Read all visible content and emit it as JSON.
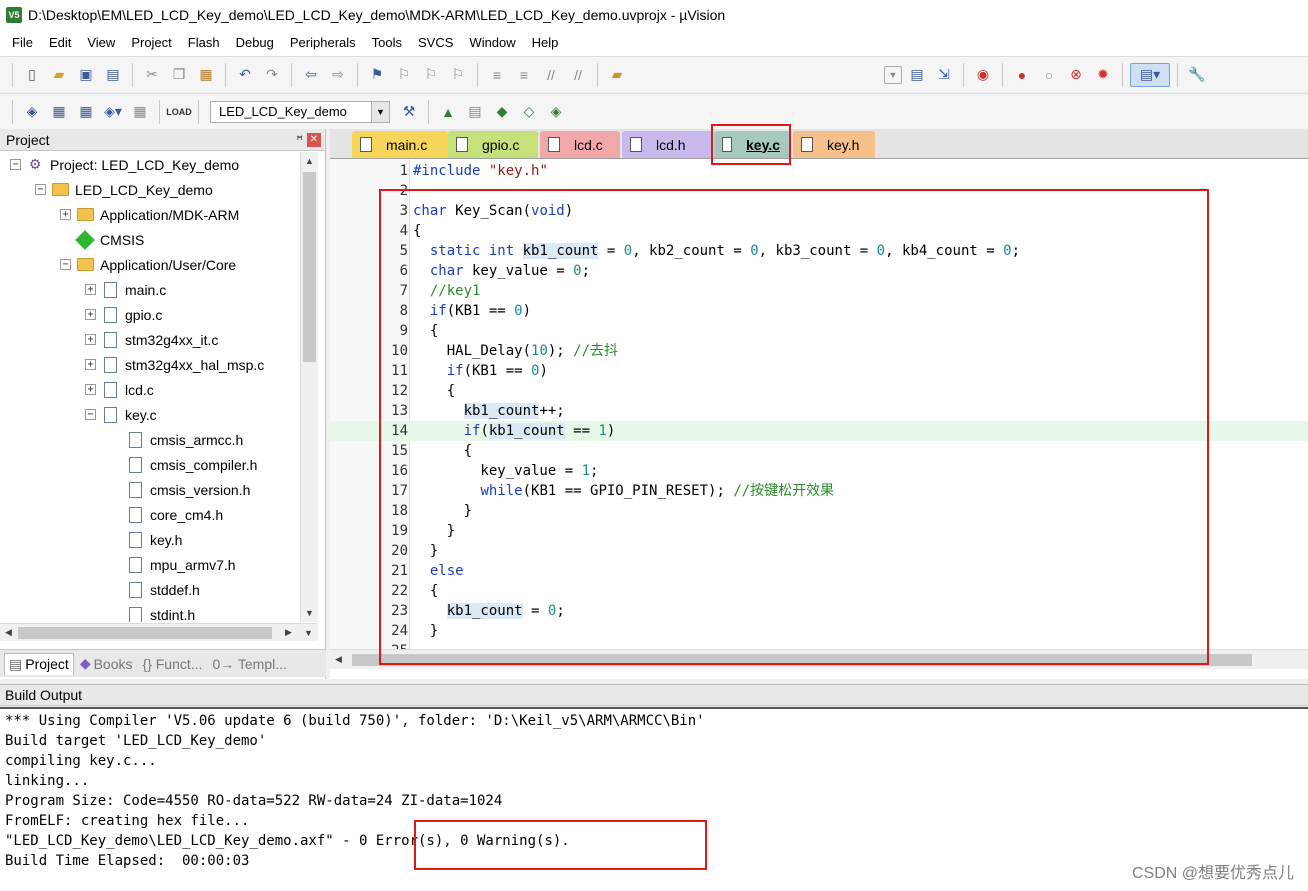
{
  "window": {
    "title": "D:\\Desktop\\EM\\LED_LCD_Key_demo\\LED_LCD_Key_demo\\MDK-ARM\\LED_LCD_Key_demo.uvprojx - µVision",
    "app_icon": "V5"
  },
  "menu": [
    "File",
    "Edit",
    "View",
    "Project",
    "Flash",
    "Debug",
    "Peripherals",
    "Tools",
    "SVCS",
    "Window",
    "Help"
  ],
  "toolbar2": {
    "target": "LED_LCD_Key_demo"
  },
  "project_panel": {
    "title": "Project",
    "tree": [
      {
        "label": "Project: LED_LCD_Key_demo",
        "icon": "project-icon",
        "expander": "⊟"
      },
      {
        "label": "LED_LCD_Key_demo",
        "icon": "target-icon",
        "expander": "⊟"
      },
      {
        "label": "Application/MDK-ARM",
        "icon": "folder-icon",
        "expander": "+"
      },
      {
        "label": "CMSIS",
        "icon": "cmsis-icon",
        "expander": ""
      },
      {
        "label": "Application/User/Core",
        "icon": "folder-icon",
        "expander": "−"
      },
      {
        "label": "main.c",
        "icon": "file-icon",
        "expander": "+"
      },
      {
        "label": "gpio.c",
        "icon": "file-icon",
        "expander": "+"
      },
      {
        "label": "stm32g4xx_it.c",
        "icon": "file-icon",
        "expander": "+"
      },
      {
        "label": "stm32g4xx_hal_msp.c",
        "icon": "file-icon",
        "expander": "+"
      },
      {
        "label": "lcd.c",
        "icon": "file-icon",
        "expander": "+"
      },
      {
        "label": "key.c",
        "icon": "file-icon",
        "expander": "−"
      },
      {
        "label": "cmsis_armcc.h",
        "icon": "file-icon",
        "expander": ""
      },
      {
        "label": "cmsis_compiler.h",
        "icon": "file-icon",
        "expander": ""
      },
      {
        "label": "cmsis_version.h",
        "icon": "file-icon",
        "expander": ""
      },
      {
        "label": "core_cm4.h",
        "icon": "file-icon",
        "expander": ""
      },
      {
        "label": "key.h",
        "icon": "file-icon",
        "expander": ""
      },
      {
        "label": "mpu_armv7.h",
        "icon": "file-icon",
        "expander": ""
      },
      {
        "label": "stddef.h",
        "icon": "file-icon",
        "expander": ""
      },
      {
        "label": "stdint.h",
        "icon": "file-icon",
        "expander": ""
      }
    ],
    "tabs": [
      "Project",
      "Books",
      "{} Funct...",
      "0→ Templ..."
    ]
  },
  "editor": {
    "tabs": [
      {
        "label": "main.c",
        "color": "#f7d55a"
      },
      {
        "label": "gpio.c",
        "color": "#c6e07a"
      },
      {
        "label": "lcd.c",
        "color": "#f2a8a8"
      },
      {
        "label": "lcd.h",
        "color": "#c8b8ec"
      },
      {
        "label": "key.c",
        "color": "#a6c8c0"
      },
      {
        "label": "key.h",
        "color": "#f6c08a"
      }
    ],
    "active_tab": "key.c",
    "highlighted_line": 14,
    "lines": [
      "#include \"key.h\"",
      "",
      "char Key_Scan(void)",
      "{",
      "  static int kb1_count = 0, kb2_count = 0, kb3_count = 0, kb4_count = 0;",
      "  char key_value = 0;",
      "  //key1",
      "  if(KB1 == 0)",
      "  {",
      "    HAL_Delay(10); //去抖",
      "    if(KB1 == 0)",
      "    {",
      "      kb1_count++;",
      "      if(kb1_count == 1)",
      "      {",
      "        key_value = 1;",
      "        while(KB1 == GPIO_PIN_RESET); //按键松开效果",
      "      }",
      "    }",
      "  }",
      "  else",
      "  {",
      "    kb1_count = 0;",
      "  }",
      ""
    ]
  },
  "build_output": {
    "title": "Build Output",
    "lines": [
      "*** Using Compiler 'V5.06 update 6 (build 750)', folder: 'D:\\Keil_v5\\ARM\\ARMCC\\Bin'",
      "Build target 'LED_LCD_Key_demo'",
      "compiling key.c...",
      "linking...",
      "Program Size: Code=4550 RO-data=522 RW-data=24 ZI-data=1024",
      "FromELF: creating hex file...",
      "\"LED_LCD_Key_demo\\LED_LCD_Key_demo.axf\" - 0 Error(s), 0 Warning(s).",
      "Build Time Elapsed:  00:00:03"
    ]
  },
  "watermark": "CSDN @想要优秀点儿"
}
